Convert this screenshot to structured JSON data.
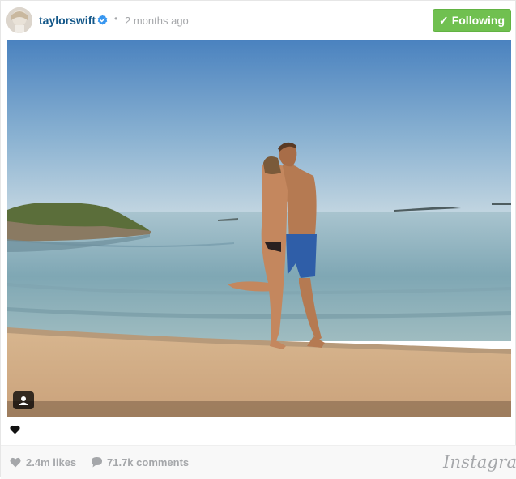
{
  "post": {
    "username": "taylorswift",
    "separator": "•",
    "timestamp": "2 months ago",
    "follow_label": "Following"
  },
  "stats": {
    "likes": "2.4m likes",
    "comments": "71.7k comments"
  },
  "branding": {
    "logo_text": "Instagram"
  },
  "icons": {
    "verified": "verified-badge-icon",
    "follow_check": "check-icon",
    "user_tag": "user-tag-icon",
    "heart": "heart-icon",
    "comment": "comment-bubble-icon"
  },
  "colors": {
    "username": "#125688",
    "follow_button": "#70c050",
    "muted_text": "#a5a7aa",
    "verified_blue": "#3897f0"
  }
}
